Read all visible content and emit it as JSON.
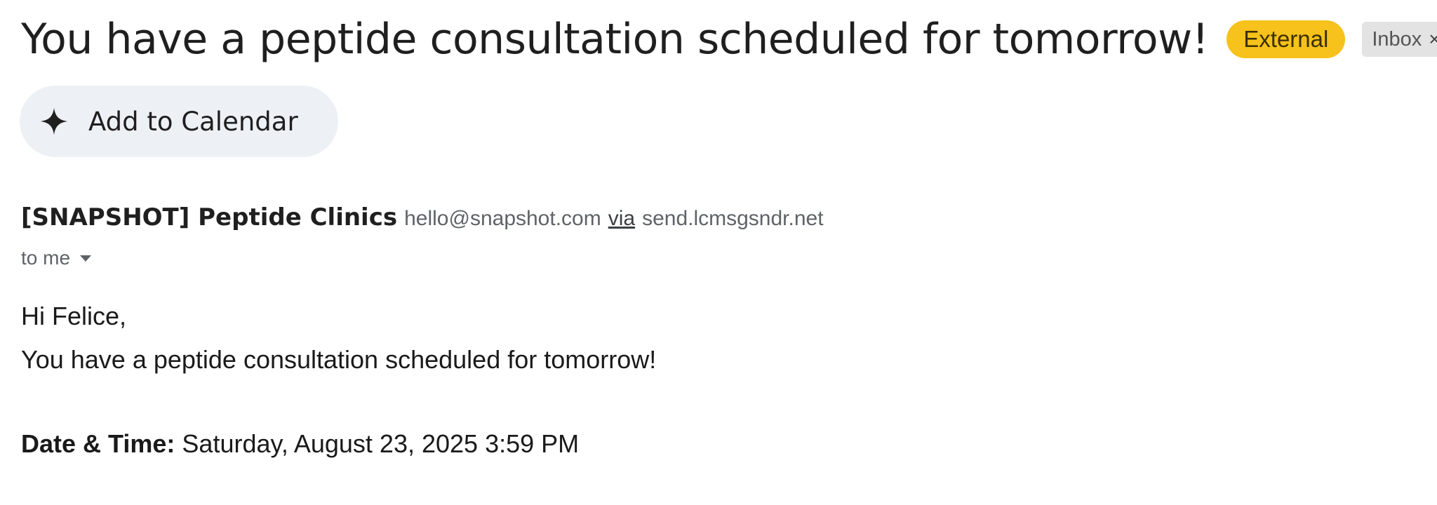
{
  "subject": "You have a peptide consultation scheduled for tomorrow!",
  "labels": {
    "external": "External",
    "inbox": "Inbox",
    "remove_icon": "×"
  },
  "calendar_chip": {
    "label": "Add to Calendar",
    "icon": "sparkle-icon"
  },
  "sender": {
    "name": "[SNAPSHOT] Peptide Clinics",
    "email": "hello@snapshot.com",
    "via": "via",
    "via_domain": "send.lcmsgsndr.net"
  },
  "recipient": {
    "to": "to me",
    "icon": "caret-down-icon"
  },
  "body": {
    "greeting": "Hi Felice,",
    "line1": "You have a peptide consultation scheduled for tomorrow!",
    "datetime_label": "Date & Time:",
    "datetime_value": "Saturday, August 23, 2025 3:59 PM"
  },
  "colors": {
    "external_badge": "#f6c21b",
    "inbox_badge": "#e3e3e3",
    "calendar_chip": "#edf1f6"
  }
}
